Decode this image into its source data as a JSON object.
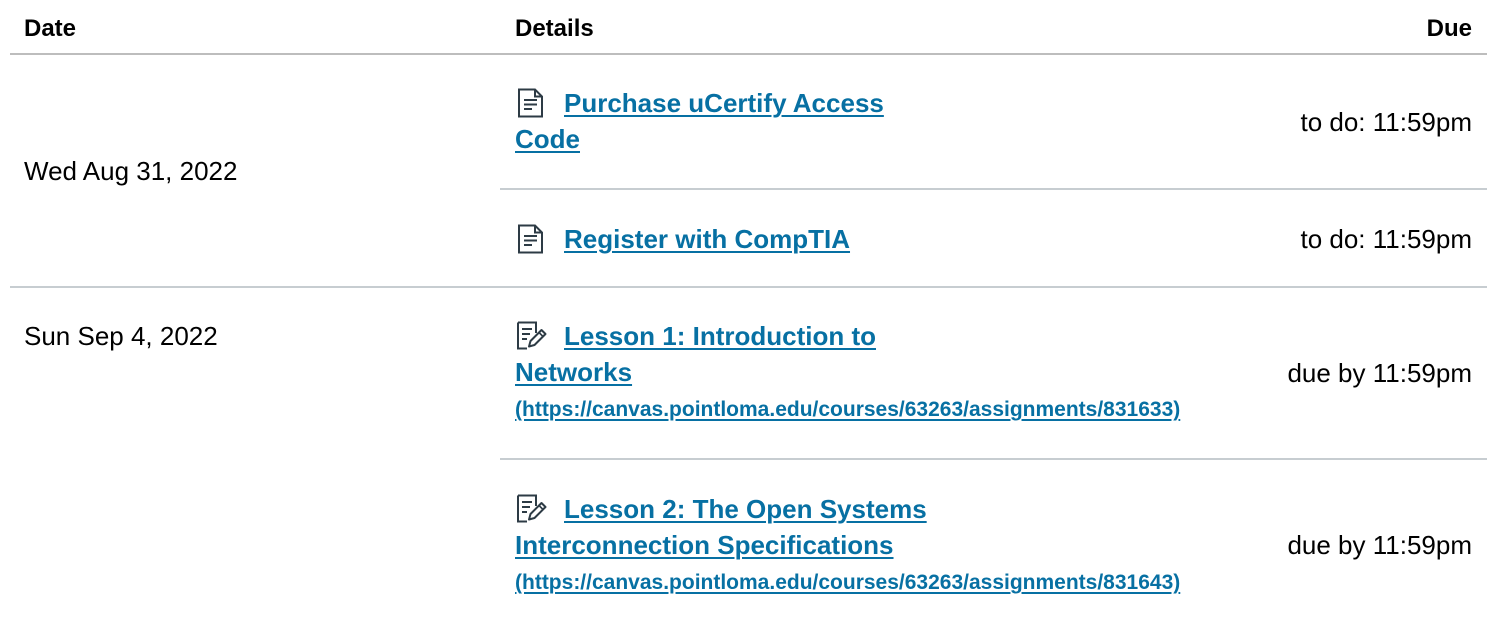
{
  "header": {
    "date": "Date",
    "details": "Details",
    "due": "Due"
  },
  "groups": [
    {
      "date": "Wed Aug 31, 2022",
      "items": [
        {
          "icon": "document-icon",
          "title_line1": "Purchase uCertify Access",
          "title_line2": "Code",
          "due": "to do: 11:59pm"
        },
        {
          "icon": "document-icon",
          "title_line1": "Register with CompTIA",
          "due": "to do: 11:59pm"
        }
      ]
    },
    {
      "date": "Sun Sep 4, 2022",
      "items": [
        {
          "icon": "assignment-edit-icon",
          "title_line1": "Lesson 1: Introduction to",
          "title_line2": "Networks",
          "url": "(https://canvas.pointloma.edu/courses/63263/assignments/831633)",
          "due": "due by 11:59pm"
        },
        {
          "icon": "assignment-edit-icon",
          "title_line1": "Lesson 2: The Open Systems",
          "title_line2": "Interconnection Specifications",
          "url": "(https://canvas.pointloma.edu/courses/63263/assignments/831643)",
          "due": "due by 11:59pm"
        }
      ]
    }
  ],
  "colors": {
    "link": "#0770a3",
    "divider": "#c7cdd1"
  }
}
